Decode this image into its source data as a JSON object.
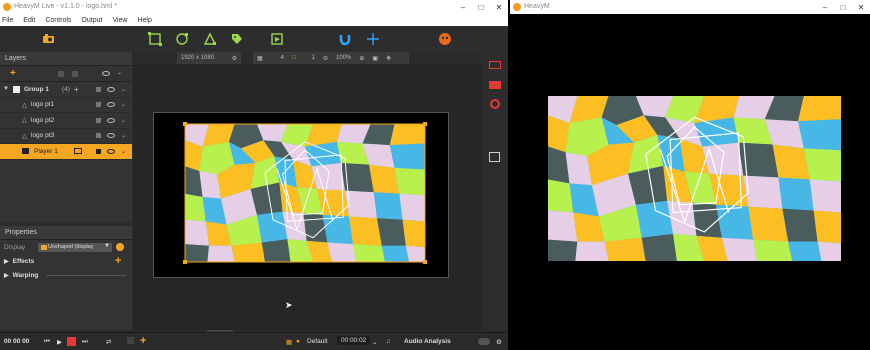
{
  "main_window": {
    "title": "HeavyM Live - v1.1.0 - logo.hml *",
    "menu": [
      "File",
      "Edit",
      "Controls",
      "Output",
      "View",
      "Help"
    ],
    "canvas_toolbar": {
      "resolution": "1920 x 1080",
      "face_count": "4",
      "count_b": "1",
      "zoom": "100%"
    },
    "layers_panel": {
      "title": "Layers",
      "items": [
        {
          "name": "Group 1",
          "count": "(4)"
        },
        {
          "name": "logo pt1"
        },
        {
          "name": "logo pt2"
        },
        {
          "name": "logo pt3"
        },
        {
          "name": "Player 1"
        }
      ]
    },
    "properties_panel": {
      "title": "Properties",
      "display_label": "Display",
      "display_value": "Unshaped (display",
      "effects_label": "Effects",
      "warping_label": "Warping"
    },
    "transport": {
      "time": "00 00 00",
      "preset": "Default",
      "duration": "00:00:02",
      "audio_label": "Audio Analysis"
    }
  },
  "output_window": {
    "title": "HeavyM"
  },
  "colors": {
    "accent": "#f5a623",
    "panel": "#333333",
    "red": "#e53935",
    "blue": "#2ea8ff"
  }
}
